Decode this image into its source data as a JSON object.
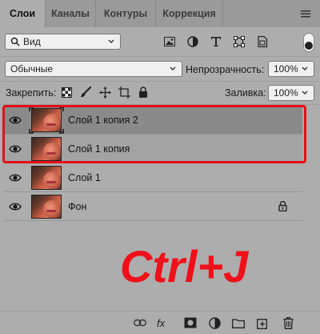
{
  "tabs": [
    {
      "label": "Слои",
      "active": true
    },
    {
      "label": "Каналы",
      "active": false
    },
    {
      "label": "Контуры",
      "active": false
    },
    {
      "label": "Коррекция",
      "active": false
    }
  ],
  "filter": {
    "kind_value": "Вид"
  },
  "blend": {
    "mode_value": "Обычные",
    "opacity_label": "Непрозрачность:",
    "opacity_value": "100%"
  },
  "lock": {
    "label": "Закрепить:",
    "fill_label": "Заливка:",
    "fill_value": "100%"
  },
  "layers": [
    {
      "name": "Слой 1 копия 2",
      "selected": true,
      "locked": false
    },
    {
      "name": "Слой 1 копия",
      "selected": true,
      "locked": false
    },
    {
      "name": "Слой 1",
      "selected": false,
      "locked": false
    },
    {
      "name": "Фон",
      "selected": false,
      "locked": true
    }
  ],
  "overlay": {
    "shortcut_text": "Ctrl+J",
    "color": "#f0101a"
  },
  "bottom_bar": {
    "fx_label": "fx"
  },
  "colors": {
    "panel_bg": "#adadad",
    "tab_bar_bg": "#9a9a9a",
    "highlight_red": "#e30f14"
  }
}
